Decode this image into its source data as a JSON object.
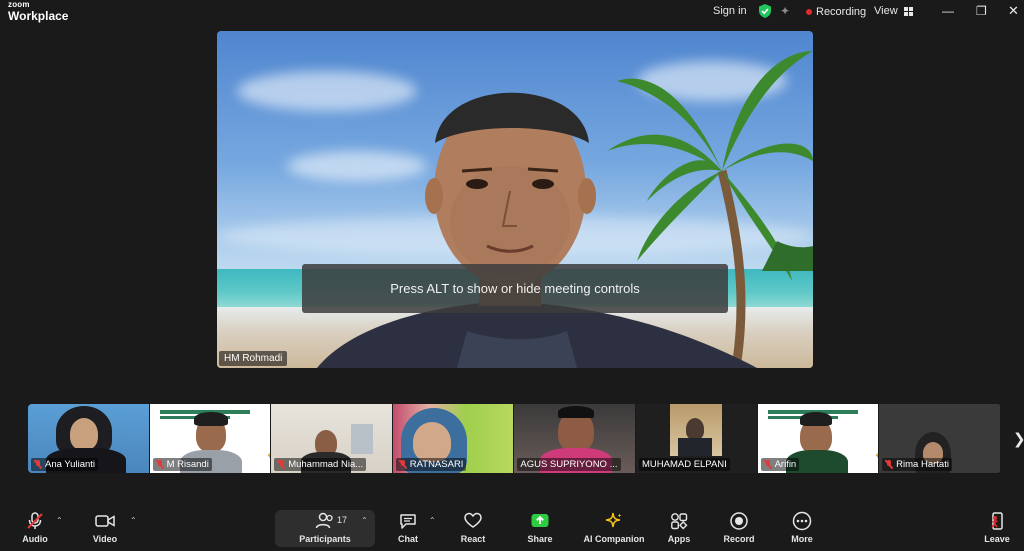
{
  "app": {
    "brand_top": "zoom",
    "brand_bottom": "Workplace"
  },
  "titlebar": {
    "signin": "Sign in",
    "recording": "Recording",
    "view": "View"
  },
  "speaker": {
    "name": "HM Rohmadi"
  },
  "toast": {
    "text": "Press ALT to show or hide meeting controls"
  },
  "participants": [
    {
      "name": "Ana Yulianti",
      "muted": true
    },
    {
      "name": "M Risandi",
      "muted": true
    },
    {
      "name": "Muhammad Nia...",
      "muted": true
    },
    {
      "name": "RATNASARI",
      "muted": true
    },
    {
      "name": "AGUS SUPRIYONO ...",
      "muted": false
    },
    {
      "name": "MUHAMAD ELPANI",
      "muted": false
    },
    {
      "name": "Arifin",
      "muted": true
    },
    {
      "name": "Rima Hartati",
      "muted": true
    }
  ],
  "toolbar": {
    "audio": "Audio",
    "video": "Video",
    "participants": "Participants",
    "participants_count": "17",
    "chat": "Chat",
    "react": "React",
    "share": "Share",
    "ai_companion": "AI Companion",
    "apps": "Apps",
    "record": "Record",
    "more": "More",
    "leave": "Leave"
  },
  "colors": {
    "share_green": "#2ecc40",
    "record_red": "#e02b2b",
    "shield_green": "#22c55e",
    "ai_gold": "#f5c518"
  }
}
